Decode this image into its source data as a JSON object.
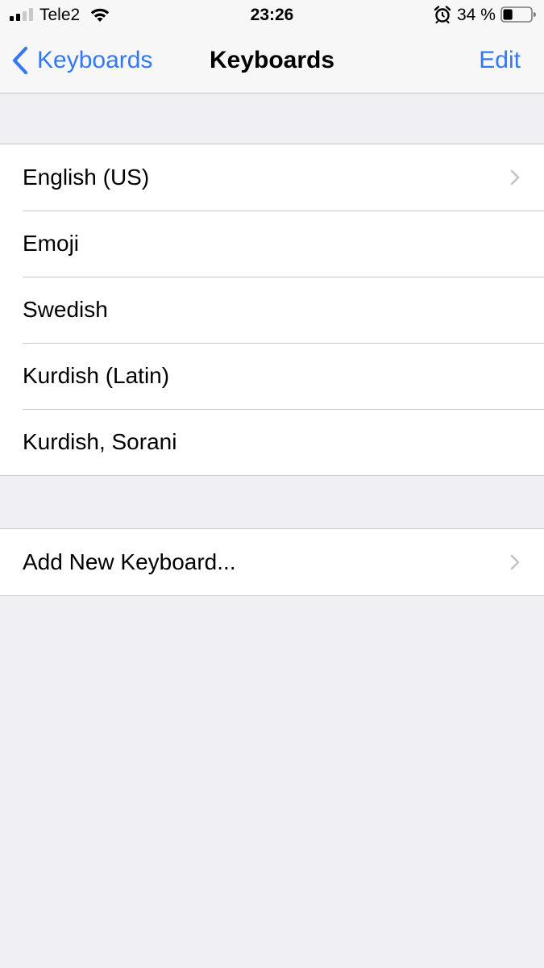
{
  "status_bar": {
    "carrier": "Tele2",
    "time": "23:26",
    "battery_percent": "34 %",
    "battery_level": 0.34,
    "signal_bars_filled": 2,
    "signal_bars_total": 4,
    "icons": [
      "signal-icon",
      "wifi-icon",
      "alarm-icon",
      "battery-icon"
    ]
  },
  "nav": {
    "back_label": "Keyboards",
    "title": "Keyboards",
    "edit_label": "Edit"
  },
  "keyboards": [
    {
      "label": "English (US)",
      "has_chevron": true
    },
    {
      "label": "Emoji",
      "has_chevron": false
    },
    {
      "label": "Swedish",
      "has_chevron": false
    },
    {
      "label": "Kurdish (Latin)",
      "has_chevron": false
    },
    {
      "label": "Kurdish, Sorani",
      "has_chevron": false
    }
  ],
  "add_keyboard": {
    "label": "Add New Keyboard..."
  },
  "colors": {
    "accent": "#3478f6",
    "background": "#efeff4",
    "separator": "#c8c7cc",
    "chevron": "#c4c4c7"
  }
}
